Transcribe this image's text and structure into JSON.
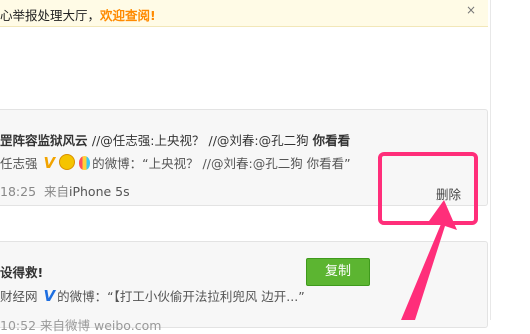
{
  "notice": {
    "text": "心举报处理大厅，",
    "link": "欢迎查阅!",
    "close": "×"
  },
  "post1": {
    "header_bold": "罡阵容监狱风云",
    "header_mid": "//@任志强:上央视？ //@刘春:@孔二狗 ",
    "header_tail": "你看看",
    "repost_author": "任志强",
    "repost_verify_badge": "V",
    "repost_icons": [
      "emoji-face-icon",
      "balloon-icon"
    ],
    "repost_text": "的微博：“上央视？ //@刘春:@孔二狗 你看看”",
    "time": "18:25",
    "source_prefix": "来自",
    "source": "iPhone 5s",
    "delete": "删除"
  },
  "post2": {
    "header": "设得救!",
    "repost_author": "财经网",
    "repost_verify_badge": "V",
    "repost_text": "的微博：“【打工小伙偷开法拉利兜风 边开...”",
    "copy": "复制",
    "meta_partial": "10:52  来自微博 weibo.com"
  },
  "colors": {
    "notice_link": "#ff8a00",
    "copy_button": "#5cb531",
    "highlight": "#ff2e7a",
    "gold_v": "#f2a400",
    "blue_v": "#1f6fe0"
  }
}
